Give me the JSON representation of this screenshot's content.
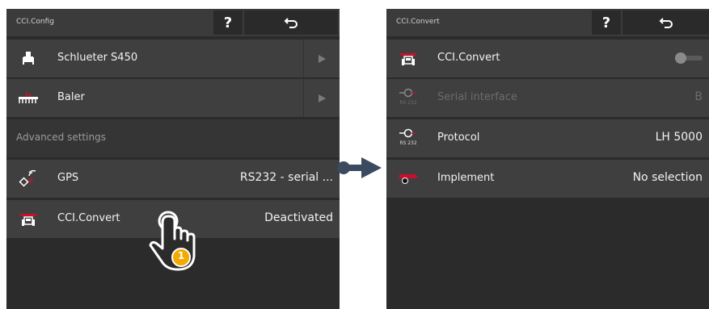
{
  "left": {
    "title": "CCI.Config",
    "help_label": "?",
    "back_label": "⮌",
    "rows": [
      {
        "label": "Schlueter S450",
        "icon": "tractor-icon"
      },
      {
        "label": "Baler",
        "icon": "baler-icon"
      }
    ],
    "section_label": "Advanced settings",
    "gps": {
      "label": "GPS",
      "value": "RS232 - serial ..."
    },
    "convert": {
      "label": "CCI.Convert",
      "value": "Deactivated"
    },
    "tap_step": "1"
  },
  "right": {
    "title": "CCI.Convert",
    "help_label": "?",
    "back_label": "⮌",
    "convert": {
      "label": "CCI.Convert",
      "enabled": false
    },
    "serial": {
      "label": "Serial interface",
      "value": "B",
      "icon_caption": "RS 232"
    },
    "protocol": {
      "label": "Protocol",
      "value": "LH 5000",
      "icon_caption": "RS 232"
    },
    "implement": {
      "label": "Implement",
      "value": "No selection"
    }
  },
  "colors": {
    "accent_red": "#c8102e",
    "badge_orange": "#f2a900",
    "arrow": "#3b4a5e"
  }
}
